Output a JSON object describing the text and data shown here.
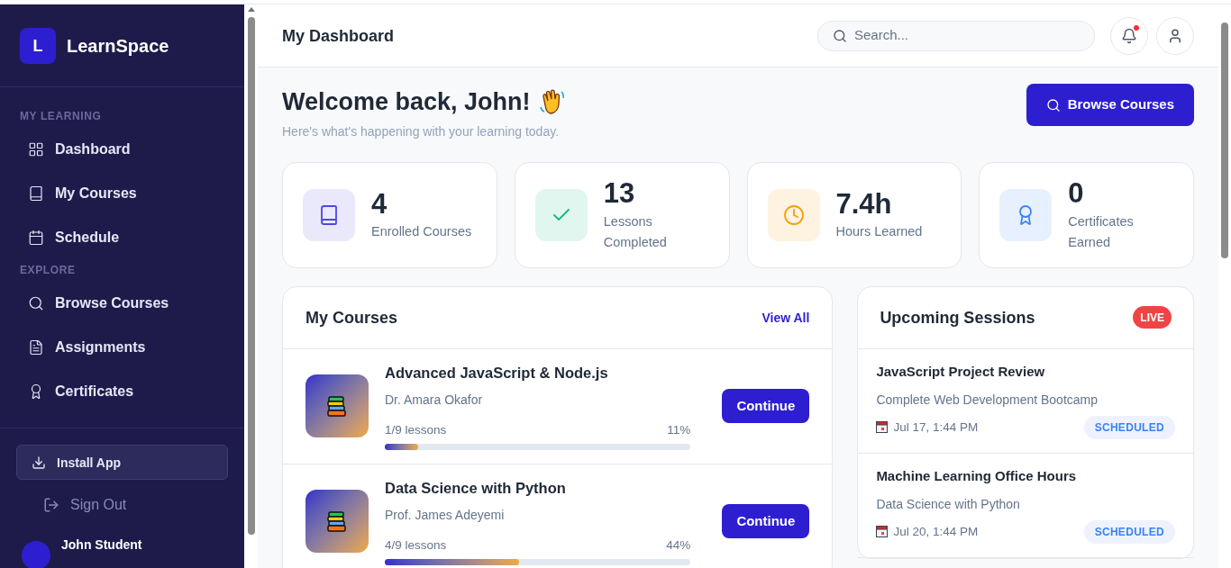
{
  "brand": {
    "logo_letter": "L",
    "name": "LearnSpace"
  },
  "sidebar": {
    "sections": [
      {
        "title": "MY LEARNING",
        "items": [
          {
            "label": "Dashboard"
          },
          {
            "label": "My Courses"
          },
          {
            "label": "Schedule"
          }
        ]
      },
      {
        "title": "EXPLORE",
        "items": [
          {
            "label": "Browse Courses"
          },
          {
            "label": "Assignments"
          },
          {
            "label": "Certificates"
          }
        ]
      }
    ],
    "install_button": "Install App",
    "sign_out": "Sign Out",
    "user": {
      "name": "John Student"
    }
  },
  "header": {
    "title": "My Dashboard",
    "search": {
      "placeholder": "Search..."
    },
    "notifications": {
      "unread": true
    }
  },
  "welcome": {
    "title": "Welcome back, John!",
    "subtitle": "Here's what's happening with your learning today.",
    "button": "Browse Courses"
  },
  "stats": [
    {
      "value": "4",
      "label": "Enrolled Courses",
      "color": "#4f46e5"
    },
    {
      "value": "13",
      "label": "Lessons Completed",
      "color": "#10b981"
    },
    {
      "value": "7.4h",
      "label": "Hours Learned",
      "color": "#f59e0b"
    },
    {
      "value": "0",
      "label": "Certificates Earned",
      "color": "#3b82f6"
    }
  ],
  "my_courses": {
    "title": "My Courses",
    "link": "View All",
    "courses": [
      {
        "title": "Advanced JavaScript & Node.js",
        "instructor": "Dr. Amara Okafor",
        "lessons": "1/9 lessons",
        "percent": "11%",
        "level": 0.11,
        "button": "Continue"
      },
      {
        "title": "Data Science with Python",
        "instructor": "Prof. James Adeyemi",
        "lessons": "4/9 lessons",
        "percent": "44%",
        "level": 0.44,
        "button": "Continue"
      }
    ]
  },
  "sessions": {
    "title": "Upcoming Sessions",
    "badge": "LIVE",
    "items": [
      {
        "title": "JavaScript Project Review",
        "course": "Complete Web Development Bootcamp",
        "time": "Jul 17, 1:44 PM",
        "status": "SCHEDULED"
      },
      {
        "title": "Machine Learning Office Hours",
        "course": "Data Science with Python",
        "time": "Jul 20, 1:44 PM",
        "status": "SCHEDULED"
      }
    ]
  }
}
